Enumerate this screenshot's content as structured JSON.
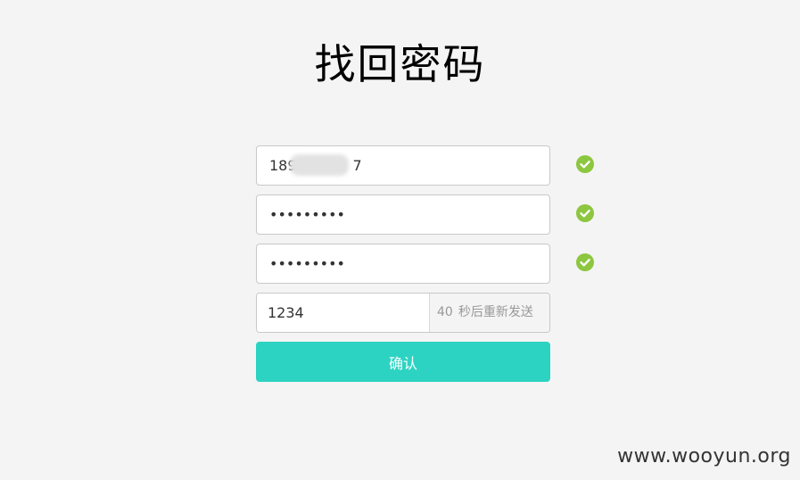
{
  "page": {
    "title": "找回密码"
  },
  "form": {
    "phone_value": "189",
    "phone_tail": "7",
    "password_value": "•••••••••",
    "confirm_password_value": "•••••••••",
    "code_value": "1234",
    "resend_count": "40",
    "resend_label": "秒后重新发送",
    "submit_label": "确认"
  },
  "validation": {
    "phone": "valid",
    "password": "valid",
    "confirm_password": "valid"
  },
  "icons": {
    "valid": "check-circle-icon"
  },
  "colors": {
    "background": "#f4f4f4",
    "accent": "#2dd3c2",
    "valid": "#8dc63f"
  },
  "watermark": "www.wooyun.org"
}
